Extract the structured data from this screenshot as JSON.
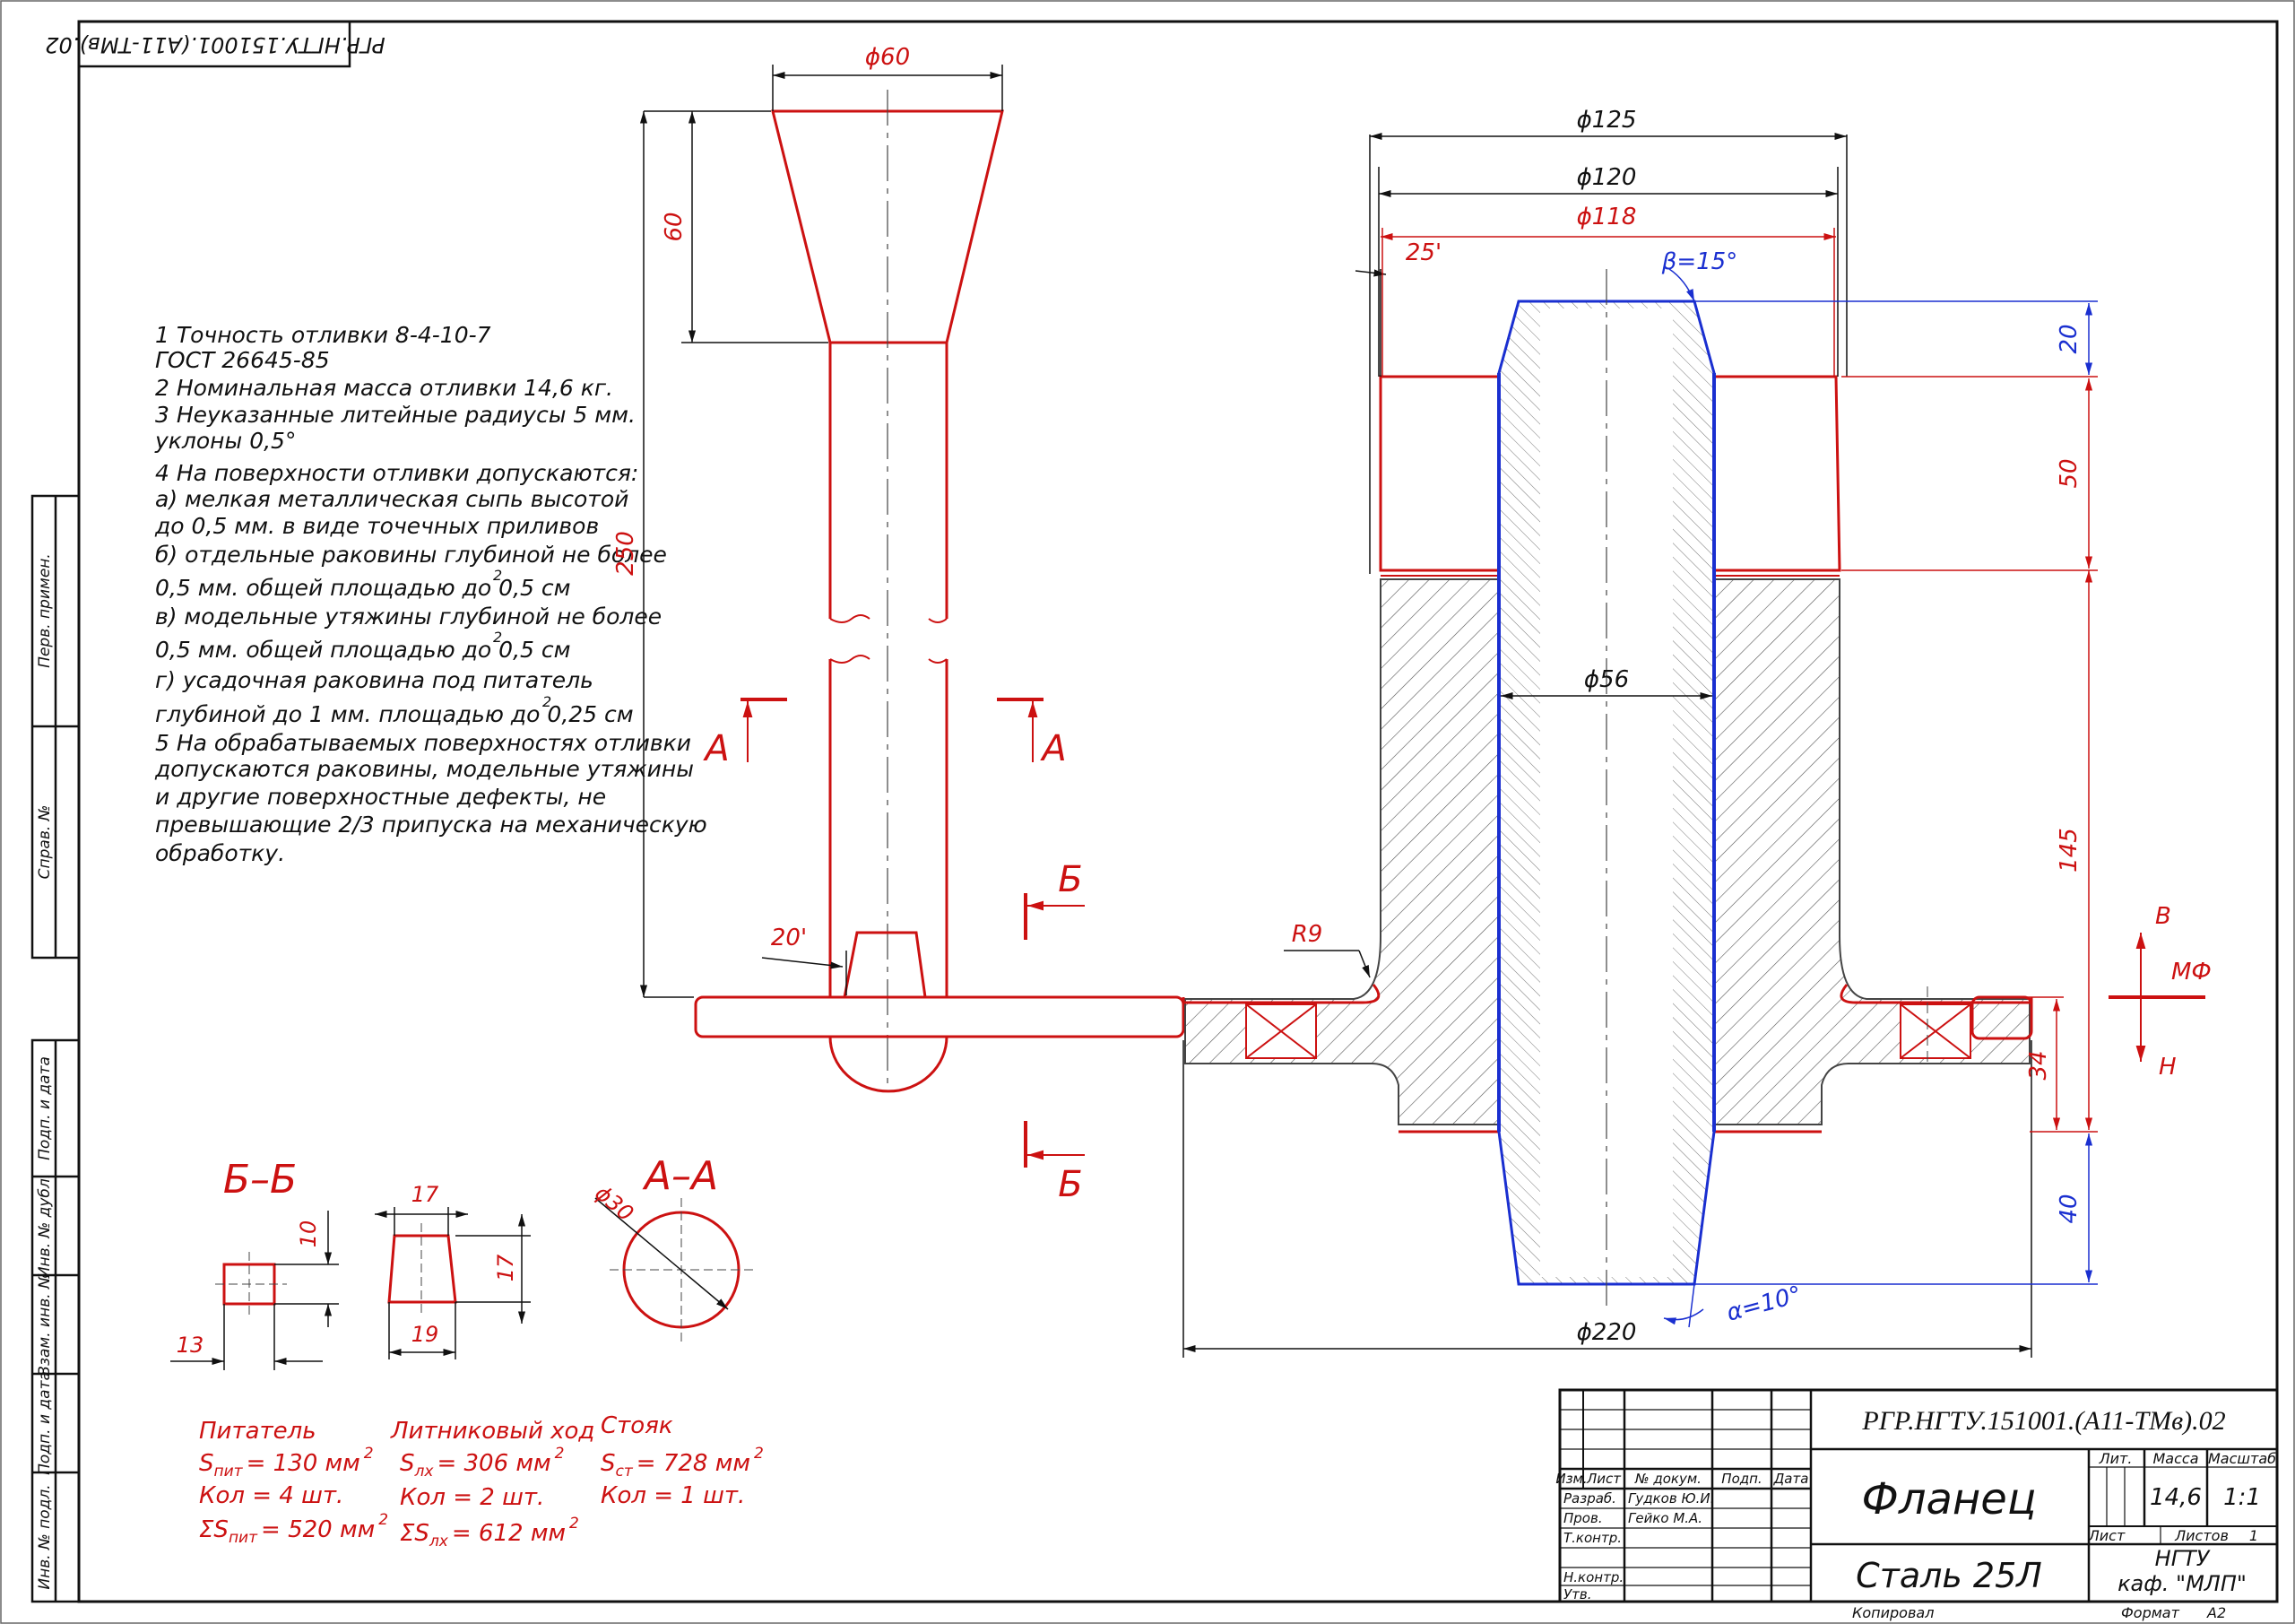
{
  "stamp": {
    "top_code": "РГР.НГТУ.151001.(А11-ТМв).02",
    "code": "РГР.НГТУ.151001.(А11-ТМв).02",
    "title": "Фланец",
    "material": "Сталь 25Л",
    "org_line1": "НГТУ",
    "org_line2": "каф. \"МЛП\"",
    "mass": "14,6",
    "scale": "1:1",
    "headers": {
      "lit": "Лит.",
      "mass": "Масса",
      "scale": "Масштаб",
      "sheet": "Лист",
      "sheets": "Листов",
      "sheets_value": "1"
    },
    "columns": {
      "izm": "Изм.",
      "list": "Лист",
      "doc": "№ докум.",
      "sign": "Подп.",
      "date": "Дата"
    },
    "roles": {
      "razrab": "Разраб.",
      "prov": "Пров.",
      "tkontr": "Т.контр.",
      "nkontr": "Н.контр.",
      "utv": "Утв."
    },
    "names": {
      "razrab": "Гудков Ю.И.",
      "prov": "Гейко М.А."
    },
    "copied": "Копировал",
    "format": "Формат",
    "format_value": "А2"
  },
  "side_strip": {
    "perv_primen": "Перв. примен.",
    "sprav": "Справ. №",
    "podp_data_1": "Подп. и дата",
    "inv_dubl": "Инв. № дубл.",
    "vzam_inv": "Взам. инв. №",
    "podp_data_2": "Подп. и дата",
    "inv_podl": "Инв. № подл."
  },
  "notes": [
    "1 Точность отливки 8-4-10-7",
    "ГОСТ 26645-85",
    "2 Номинальная масса отливки 14,6 кг.",
    "3 Неуказанные литейные радиусы 5 мм.",
    "уклоны 0,5°",
    "4 На поверхности отливки допускаются:",
    "а) мелкая металлическая сыпь высотой",
    "до 0,5 мм. в виде точечных приливов",
    "б) отдельные раковины глубиной не более",
    "0,5 мм. общей площадью до 0,5 см",
    "в) модельные утяжины глубиной не более",
    "0,5 мм. общей площадью до 0,5 см",
    "г) усадочная раковина под питатель",
    "глубиной до 1 мм. площадью до 0,25 см",
    "5 На обрабатываемых поверхностях отливки",
    "допускаются раковины, модельные утяжины",
    "и другие поверхностные дефекты, не",
    "превышающие 2/3 припуска на механическую",
    "обработку."
  ],
  "superscript": "2",
  "sections": {
    "bb": "Б–Б",
    "aa": "А–А",
    "a_mark": "А",
    "b_mark": "Б"
  },
  "dims": {
    "d60": "ϕ60",
    "h60": "60",
    "h250": "250",
    "ang20": "20'",
    "d125": "ϕ125",
    "d120": "ϕ120",
    "d118": "ϕ118",
    "ang25": "25'",
    "beta": "β=15°",
    "d56": "ϕ56",
    "r9": "R9",
    "d220": "ϕ220",
    "alpha": "α=10°",
    "v20": "20",
    "v50": "50",
    "v145": "145",
    "v34": "34",
    "v40": "40",
    "s17": "17",
    "s10": "10",
    "s13": "13",
    "s17b": "17",
    "s19": "19",
    "d30": "ϕ30",
    "mark_v": "В",
    "mark_mf": "МФ",
    "mark_n": "Н"
  },
  "gating": {
    "feeder": {
      "title": "Питатель",
      "s_label": "S",
      "s_sub": "пит",
      "s_value": "= 130 мм",
      "count": "Кол = 4 шт.",
      "sum_label": "ΣS",
      "sum_sub": "пит",
      "sum_value": "= 520 мм"
    },
    "runner": {
      "title": "Литниковый ход",
      "s_label": "S",
      "s_sub": "лх",
      "s_value": "= 306 мм",
      "count": "Кол = 2 шт.",
      "sum_label": "ΣS",
      "sum_sub": "лх",
      "sum_value": "= 612 мм"
    },
    "sprue": {
      "title": "Стояк",
      "s_label": "S",
      "s_sub": "ст",
      "s_value": "= 728 мм",
      "count": "Кол = 1 шт."
    }
  },
  "colors": {
    "red": "#cc1111",
    "blue": "#1a2fd0",
    "black": "#111111"
  }
}
